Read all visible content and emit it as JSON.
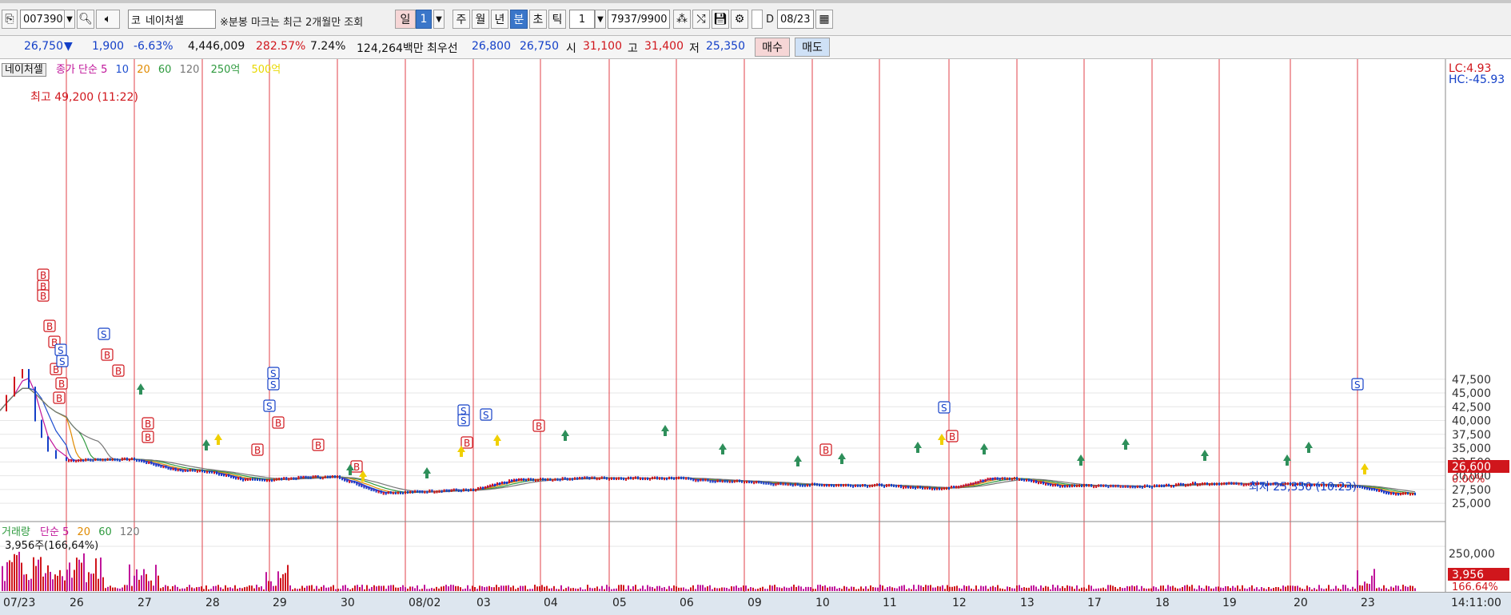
{
  "toolbar": {
    "code": "007390",
    "market_tag": "코",
    "stock_name": "네이처셀",
    "hint": "※분봉 마크는 최근 2개월만 조회",
    "periods": [
      "일",
      "1",
      "주",
      "월",
      "년",
      "분",
      "초",
      "틱"
    ],
    "interval": "1",
    "count": "7937/9900",
    "date_checkbox_label": "D",
    "date": "08/23"
  },
  "quote": {
    "price": "26,750",
    "arrow": "▼",
    "change": "1,900",
    "change_pct": "-6.63%",
    "volume": "4,446,009",
    "vol_ratio": "282.57%",
    "turnover": "7.24%",
    "amount": "124,264백만",
    "ask_label": "최우선",
    "ask": "26,800",
    "bid": "26,750",
    "open_label": "시",
    "open": "31,100",
    "high_label": "고",
    "high": "31,400",
    "low_label": "저",
    "low": "25,350",
    "buy": "매수",
    "sell": "매도"
  },
  "legend": {
    "name": "네이처셀",
    "ma_label": "종가 단순",
    "ma": [
      "5",
      "10",
      "20",
      "60",
      "120"
    ],
    "extra1": "250억",
    "extra2": "500억",
    "vol_label": "거래량",
    "vol_ma_label": "단순",
    "vol_ma": [
      "5",
      "20",
      "60",
      "120"
    ],
    "vol_value": "3,956주(166,64%)"
  },
  "annotations": {
    "high": "최고 49,200 (11:22)",
    "low": "최저 25,350 (10:23)",
    "lc": "LC:4.93",
    "hc": "HC:-45.93",
    "last_price": "26,600",
    "last_pct": "0.00%",
    "last_vol": "3,956",
    "last_vol_pct": "166.64%",
    "time": "14:11:00"
  },
  "y_ticks": [
    "47,500",
    "45,000",
    "42,500",
    "40,000",
    "37,500",
    "35,000",
    "32,500",
    "30,000",
    "27,500",
    "25,000"
  ],
  "vol_ticks": [
    "250,000"
  ],
  "x_labels": [
    "07/23",
    "26",
    "27",
    "28",
    "29",
    "30",
    "08/02",
    "03",
    "04",
    "05",
    "06",
    "09",
    "10",
    "11",
    "12",
    "13",
    "17",
    "18",
    "19",
    "20",
    "23"
  ],
  "colors": {
    "up": "#d0161c",
    "down": "#1440c8",
    "ma5": "#c0159a",
    "ma10": "#1f4fd0",
    "ma20": "#e08a00",
    "ma60": "#2e9a3e",
    "ma120": "#777777",
    "separator": "#e0424a"
  },
  "chart_data": {
    "type": "line",
    "title": "네이처셀",
    "x": [
      "07/23",
      "26",
      "27",
      "28",
      "29",
      "30",
      "08/02",
      "03",
      "04",
      "05",
      "06",
      "09",
      "10",
      "11",
      "12",
      "13",
      "17",
      "18",
      "19",
      "20",
      "23"
    ],
    "series": [
      {
        "name": "종가",
        "values": [
          48500,
          33000,
          31000,
          29300,
          29800,
          27000,
          27400,
          29300,
          29600,
          29600,
          29000,
          28400,
          28300,
          27800,
          29500,
          28200,
          28100,
          28600,
          28500,
          28200,
          26750
        ]
      }
    ],
    "ylim": [
      23800,
      50500
    ]
  }
}
